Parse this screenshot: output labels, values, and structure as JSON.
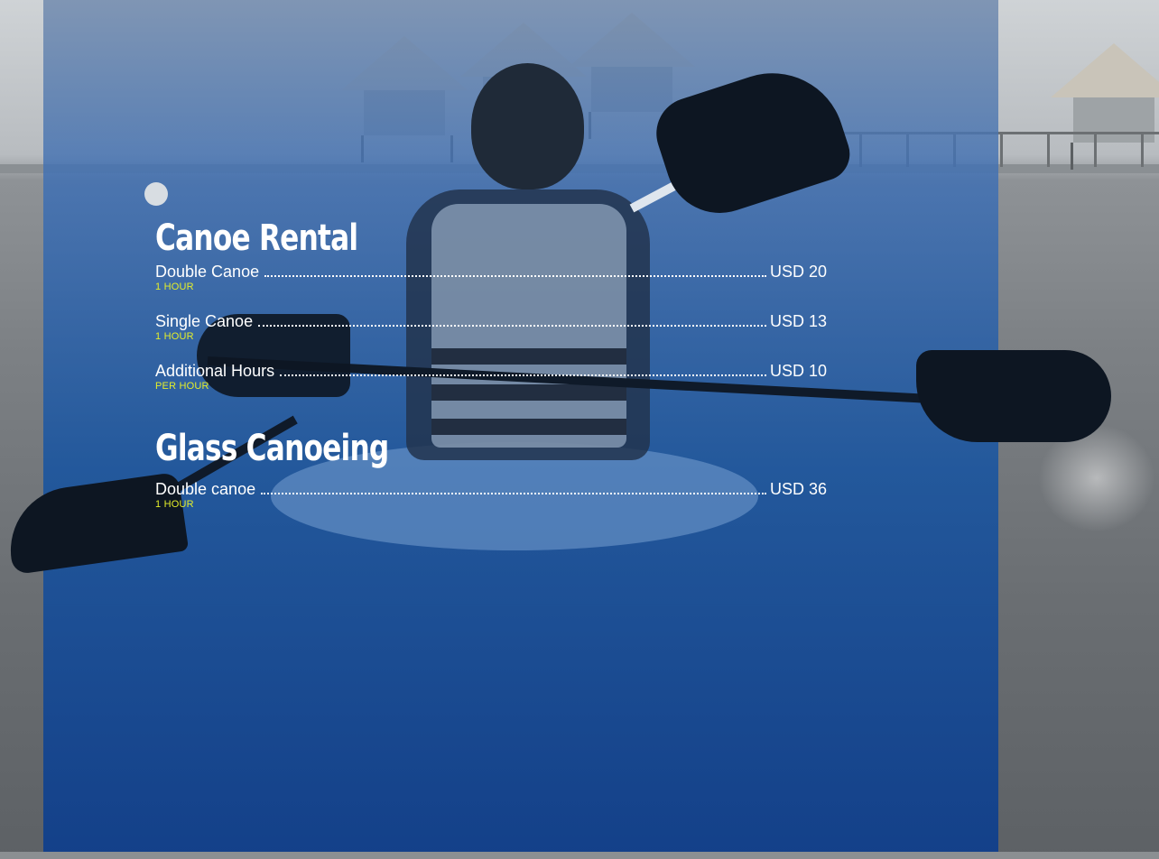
{
  "colors": {
    "panel_blue": "#1854a0",
    "title_white": "#ffffff",
    "unit_yellow": "#e4ee2a"
  },
  "sections": [
    {
      "title": "Canoe Rental",
      "items": [
        {
          "name": "Double Canoe",
          "price": "USD 20",
          "unit": "1 HOUR"
        },
        {
          "name": "Single Canoe",
          "price": "USD 13",
          "unit": "1 HOUR"
        },
        {
          "name": "Additional Hours",
          "price": "USD 10",
          "unit": "PER HOUR"
        }
      ]
    },
    {
      "title": "Glass Canoeing",
      "items": [
        {
          "name": "Double canoe",
          "price": "USD 36",
          "unit": "1 HOUR"
        }
      ]
    }
  ]
}
